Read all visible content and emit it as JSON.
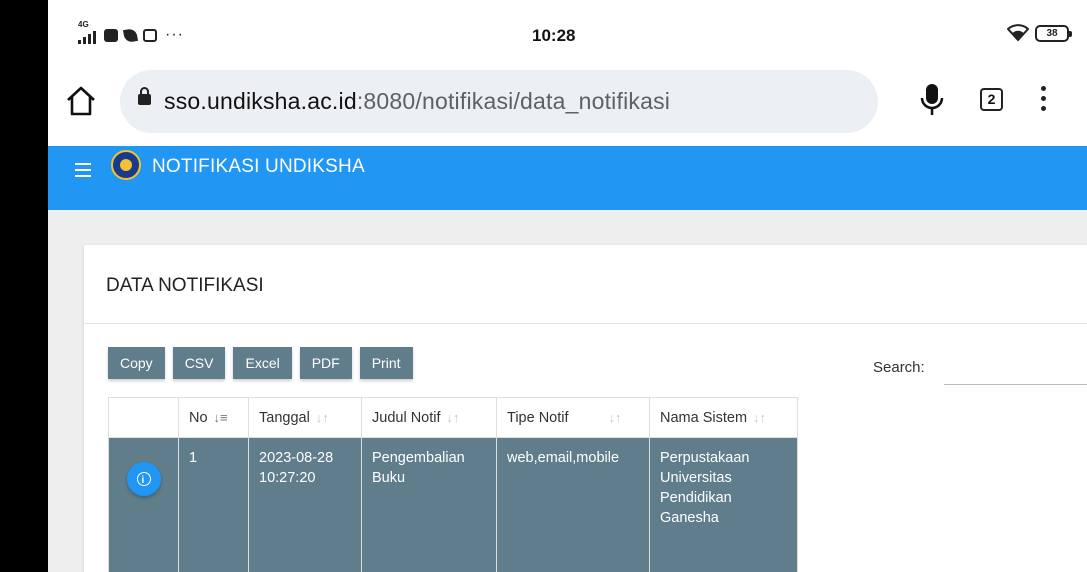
{
  "status_bar": {
    "network": "4G",
    "time": "10:28",
    "battery": "38",
    "more_indicator": "···"
  },
  "browser": {
    "url_host": "sso.undiksha.ac.id",
    "url_path": ":8080/notifikasi/data_notifikasi",
    "tab_count": "2"
  },
  "app": {
    "title": "NOTIFIKASI UNDIKSHA"
  },
  "card": {
    "title": "DATA NOTIFIKASI"
  },
  "toolbar": {
    "buttons": [
      "Copy",
      "CSV",
      "Excel",
      "PDF",
      "Print"
    ],
    "search_label": "Search:"
  },
  "table": {
    "headers": [
      "",
      "No",
      "Tanggal",
      "Judul Notif",
      "Tipe Notif",
      "Nama Sistem"
    ],
    "rows": [
      {
        "no": "1",
        "tanggal": "2023-08-28 10:27:20",
        "judul": "Pengembalian Buku",
        "tipe": "web,email,mobile",
        "sistem": "Perpustakaan Universitas Pendidikan Ganesha"
      }
    ]
  },
  "colors": {
    "app_bar": "#2196f3",
    "button": "#607d8b",
    "row": "#607d8b",
    "info_button": "#2196f3"
  }
}
